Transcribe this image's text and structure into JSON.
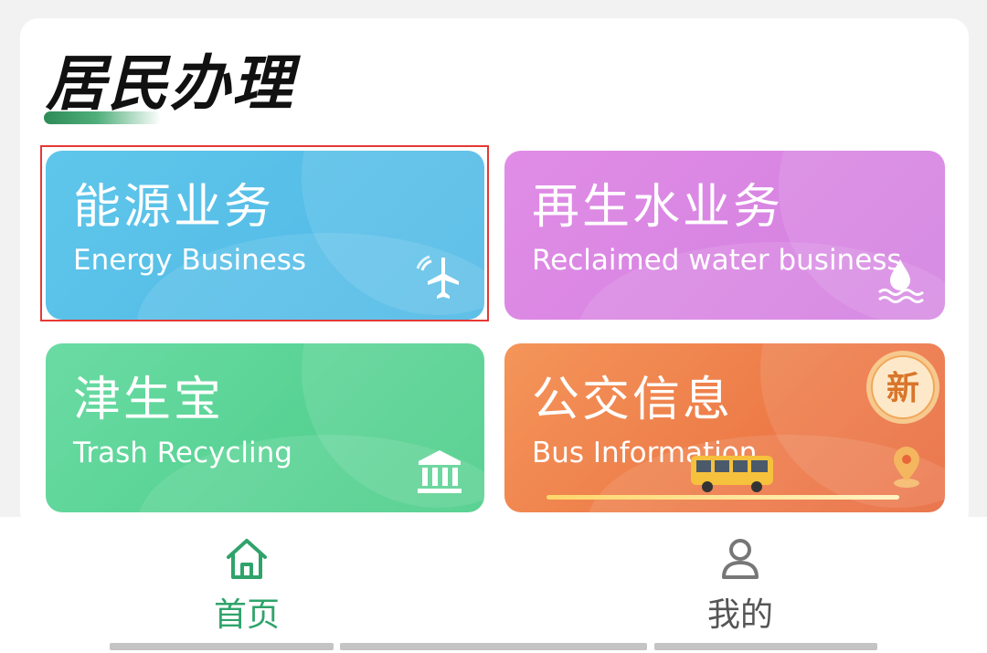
{
  "section": {
    "title": "居民办理"
  },
  "cards": [
    {
      "name": "能源业务",
      "sub": "Energy Business",
      "icon": "airplane-icon"
    },
    {
      "name": "再生水业务",
      "sub": "Reclaimed water business",
      "icon": "water-drop-icon"
    },
    {
      "name": "津生宝",
      "sub": "Trash Recycling",
      "icon": "building-icon"
    },
    {
      "name": "公交信息",
      "sub": "Bus Information",
      "icon": "bus-icon",
      "badge": "新"
    }
  ],
  "tabs": [
    {
      "label": "首页",
      "icon": "home-icon",
      "active": true
    },
    {
      "label": "我的",
      "icon": "user-icon",
      "active": false
    }
  ],
  "colors": {
    "energy": "#4fb8e6",
    "water": "#d27fe0",
    "trash": "#48cc86",
    "bus": "#e8673a",
    "accent": "#2fa36b",
    "selection": "#e53935"
  }
}
